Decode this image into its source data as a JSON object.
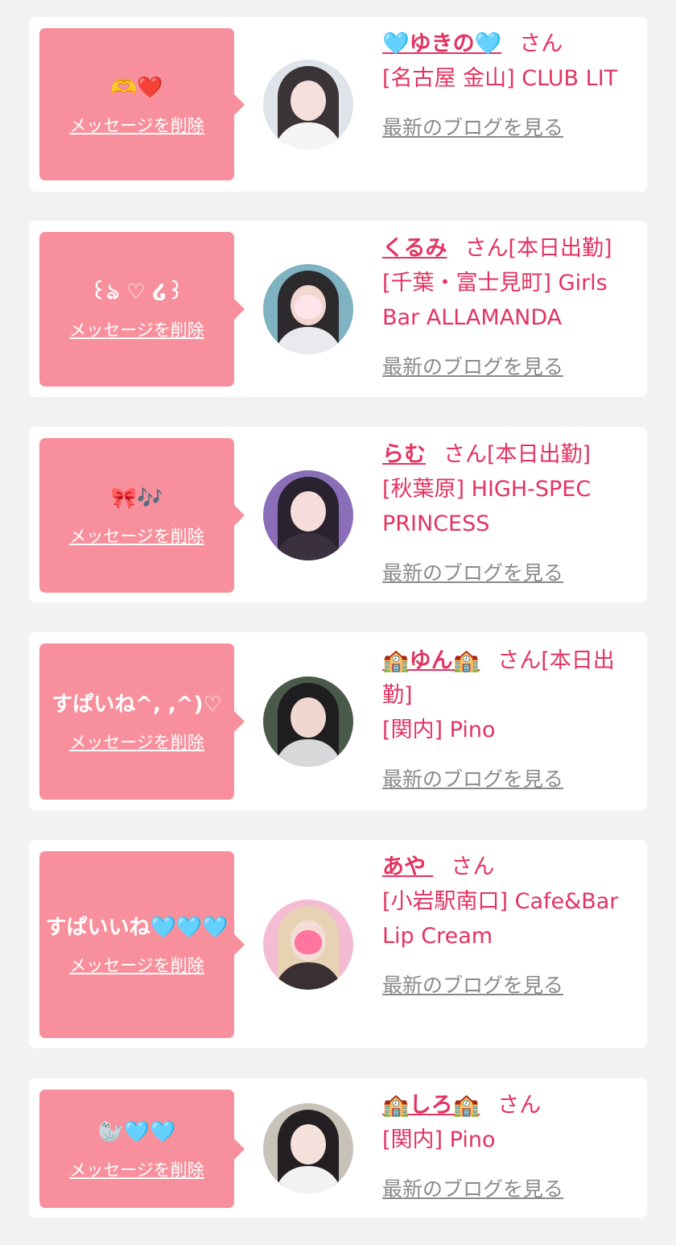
{
  "colors": {
    "background": "#f2f2f2",
    "card": "#ffffff",
    "bubble": "#f7909c",
    "accent": "#e33361",
    "link_gray": "#8a8a8a"
  },
  "delete_label": "メッセージを削除",
  "san_label": "さん",
  "blog_label": "最新のブログを見る",
  "cards": [
    {
      "message": "🫶❤️",
      "name": "🩵ゆきの🩵",
      "status": "",
      "shop": "[名古屋 金山] CLUB LIT",
      "avatar_icon": "user-avatar"
    },
    {
      "message": "꒰ঌ ♡ ໒꒱",
      "name": "くるみ",
      "status": "[本日出勤]",
      "shop": "[千葉・富士見町] Girls Bar ALLAMANDA",
      "avatar_icon": "user-avatar"
    },
    {
      "message": "🎀🎶",
      "name": "らむ",
      "status": "[本日出勤]",
      "shop": "[秋葉原] HIGH-SPEC PRINCESS",
      "avatar_icon": "user-avatar"
    },
    {
      "message": "すぱいね^, ,^)♡",
      "name": "🏫ゆん🏫",
      "status": "[本日出勤]",
      "shop": "[関内] Pino",
      "avatar_icon": "user-avatar"
    },
    {
      "message": "すぱいいね🩵🩵🩵",
      "name": "あや ",
      "status": "",
      "shop": "[小岩駅南口] Cafe&Bar Lip Cream",
      "avatar_icon": "user-avatar"
    },
    {
      "message": "🦭🩵🩵",
      "name": "🏫しろ🏫",
      "status": "",
      "shop": "[関内] Pino",
      "avatar_icon": "user-avatar"
    }
  ]
}
